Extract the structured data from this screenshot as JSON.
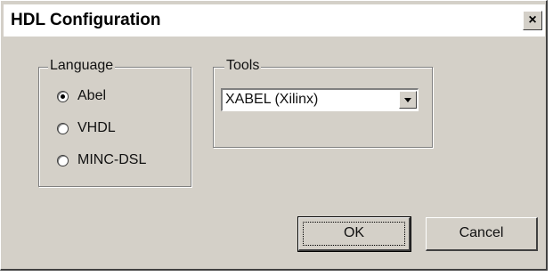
{
  "window": {
    "title": "HDL Configuration",
    "close_symbol": "×"
  },
  "language_group": {
    "label": "Language",
    "options": [
      {
        "label": "Abel",
        "checked": true
      },
      {
        "label": "VHDL",
        "checked": false
      },
      {
        "label": "MINC-DSL",
        "checked": false
      }
    ]
  },
  "tools_group": {
    "label": "Tools",
    "selected_value": "XABEL (Xilinx)"
  },
  "buttons": {
    "ok_label": "OK",
    "cancel_label": "Cancel"
  },
  "colors": {
    "face": "#d4d0c8",
    "shadow": "#808080",
    "highlight": "#ffffff"
  }
}
